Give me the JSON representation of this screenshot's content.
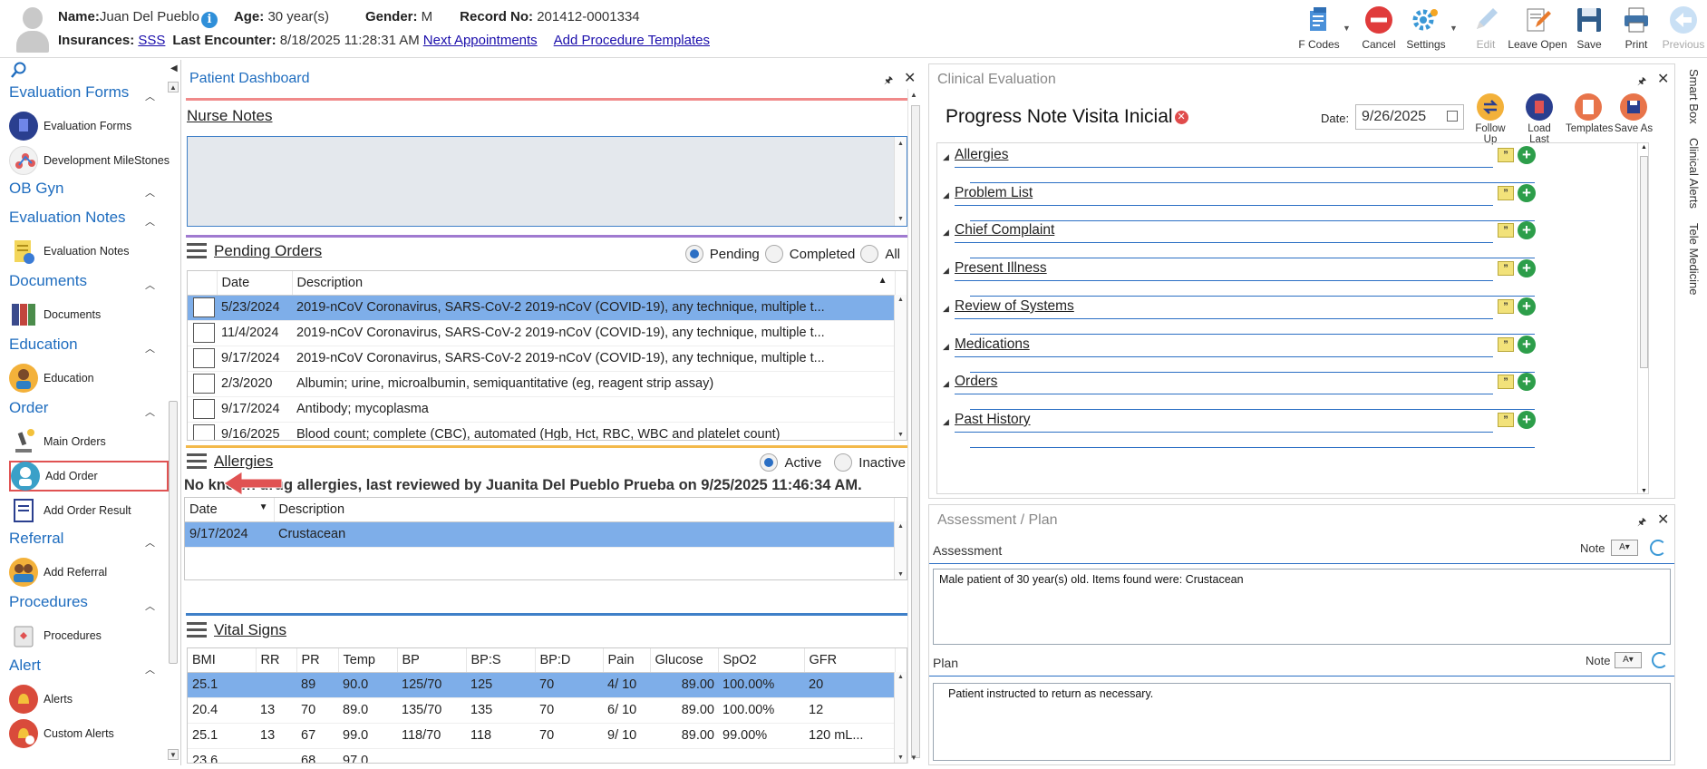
{
  "patient": {
    "name_label": "Name:",
    "name": "Juan Del Pueblo",
    "age_label": "Age:",
    "age": "30 year(s)",
    "gender_label": "Gender:",
    "gender": "M",
    "record_label": "Record No:",
    "record": "201412-0001334",
    "insurances_label": "Insurances:",
    "insurance": "SSS",
    "last_encounter_label": "Last Encounter:",
    "last_encounter": "8/18/2025 11:28:31 AM",
    "next_appointments": "Next Appointments",
    "add_procedure_templates": "Add Procedure Templates"
  },
  "toolbar": [
    {
      "label": "F Codes",
      "icon": "fcodes-icon",
      "has_dropdown": true
    },
    {
      "label": "Cancel",
      "icon": "cancel-icon"
    },
    {
      "label": "Settings",
      "icon": "gear-icon",
      "has_dropdown": true
    },
    {
      "label": "Edit",
      "icon": "pencil-icon",
      "disabled": true
    },
    {
      "label": "Leave Open",
      "icon": "leave-open-icon"
    },
    {
      "label": "Save",
      "icon": "save-icon"
    },
    {
      "label": "Print",
      "icon": "printer-icon"
    },
    {
      "label": "Previous",
      "icon": "back-arrow-icon",
      "disabled": true
    }
  ],
  "sidebar": {
    "sections": [
      {
        "title": "Evaluation Forms",
        "items": [
          "Evaluation Forms",
          "Development MileStones"
        ]
      },
      {
        "title": "OB Gyn",
        "items": []
      },
      {
        "title": "Evaluation Notes",
        "items": [
          "Evaluation Notes"
        ]
      },
      {
        "title": "Documents",
        "items": [
          "Documents"
        ]
      },
      {
        "title": "Education",
        "items": [
          "Education"
        ]
      },
      {
        "title": "Order",
        "items": [
          "Main Orders",
          "Add Order",
          "Add Order Result"
        ]
      },
      {
        "title": "Referral",
        "items": [
          "Add Referral"
        ]
      },
      {
        "title": "Procedures",
        "items": [
          "Procedures"
        ]
      },
      {
        "title": "Alert",
        "items": [
          "Alerts",
          "Custom Alerts"
        ]
      }
    ],
    "selected_item": "Add Order"
  },
  "dashboard": {
    "title": "Patient Dashboard",
    "nurse_notes": {
      "title": "Nurse Notes",
      "text": ""
    },
    "pending_orders": {
      "title": "Pending Orders",
      "filters": [
        "Pending",
        "Completed",
        "All"
      ],
      "selected_filter": "Pending",
      "columns": [
        "Date",
        "Description"
      ],
      "rows": [
        {
          "date": "5/23/2024",
          "description": "2019-nCoV Coronavirus, SARS-CoV-2 2019-nCoV (COVID-19), any technique, multiple t...",
          "selected": true
        },
        {
          "date": "11/4/2024",
          "description": "2019-nCoV Coronavirus, SARS-CoV-2 2019-nCoV (COVID-19), any technique, multiple t..."
        },
        {
          "date": "9/17/2024",
          "description": "2019-nCoV Coronavirus, SARS-CoV-2 2019-nCoV (COVID-19), any technique, multiple t..."
        },
        {
          "date": "2/3/2020",
          "description": "Albumin; urine, microalbumin, semiquantitative (eg, reagent strip assay)"
        },
        {
          "date": "9/17/2024",
          "description": "Antibody; mycoplasma"
        },
        {
          "date": "9/16/2025",
          "description": "Blood count; complete (CBC), automated (Hgb, Hct, RBC, WBC and platelet count)"
        }
      ]
    },
    "allergies": {
      "title": "Allergies",
      "filters": [
        "Active",
        "Inactive"
      ],
      "selected_filter": "Active",
      "summary": "No known drug allergies, last reviewed by Juanita Del Pueblo Prueba on 9/25/2025 11:46:34 AM.",
      "columns": [
        "Date",
        "Description"
      ],
      "rows": [
        {
          "date": "9/17/2024",
          "description": "Crustacean",
          "selected": true
        }
      ]
    },
    "vital_signs": {
      "title": "Vital Signs",
      "columns": [
        "BMI",
        "RR",
        "PR",
        "Temp",
        "BP",
        "BP:S",
        "BP:D",
        "Pain",
        "Glucose",
        "SpO2",
        "GFR"
      ],
      "rows": [
        [
          "25.1",
          "",
          "89",
          "90.0",
          "125/70",
          "125",
          "70",
          "4/ 10",
          "89.00",
          "100.00%",
          "20"
        ],
        [
          "20.4",
          "13",
          "70",
          "89.0",
          "135/70",
          "135",
          "70",
          "6/ 10",
          "89.00",
          "100.00%",
          "12"
        ],
        [
          "25.1",
          "13",
          "67",
          "99.0",
          "118/70",
          "118",
          "70",
          "9/ 10",
          "89.00",
          "99.00%",
          "120 mL..."
        ],
        [
          "23.6",
          "",
          "68",
          "97.0",
          "",
          "",
          "",
          "",
          "",
          "",
          ""
        ]
      ]
    }
  },
  "clinical_evaluation": {
    "title": "Clinical Evaluation",
    "note_title": "Progress Note Visita Inicial",
    "date_label": "Date:",
    "date": "9/26/2025",
    "actions": [
      {
        "label": "Follow Up",
        "icon": "follow-up-icon"
      },
      {
        "label": "Load Last",
        "icon": "load-last-icon"
      },
      {
        "label": "Templates",
        "icon": "templates-icon"
      },
      {
        "label": "Save As",
        "icon": "save-as-icon"
      }
    ],
    "sections": [
      "Allergies",
      "Problem List",
      "Chief Complaint",
      "Present Illness",
      "Review of Systems",
      "Medications",
      "Orders",
      "Past History"
    ]
  },
  "assessment_plan": {
    "title": "Assessment / Plan",
    "assessment_label": "Assessment",
    "plan_label": "Plan",
    "note_label": "Note",
    "assessment_text": "Male patient of 30 year(s) old. Items found were:  Crustacean",
    "plan_text": "Patient instructed to return as necessary."
  },
  "side_tabs": [
    "Smart Box",
    "Clinical Alerts",
    "Tele Medicine"
  ],
  "colors": {
    "accent_blue": "#1f6dbf",
    "selection": "#7eaee9",
    "nurse_bar": "#f08a8a",
    "orders_bar": "#a07ad0",
    "allergies_bar": "#f3b94a",
    "vitals_bar": "#3f80c8",
    "callout_red": "#e05252"
  }
}
